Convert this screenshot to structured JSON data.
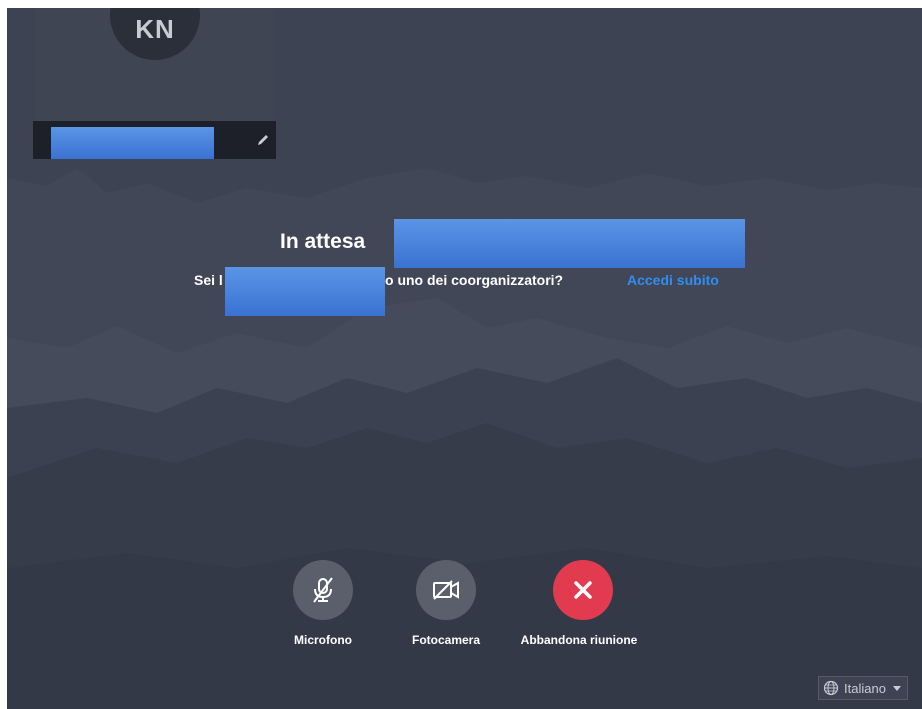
{
  "preview": {
    "initials": "KN"
  },
  "waiting": {
    "title": "In attesa",
    "question_prefix": "Sei l",
    "question_suffix": "o uno dei coorganizzatori?",
    "sign_in_link": "Accedi subito"
  },
  "controls": {
    "microphone_label": "Microfono",
    "camera_label": "Fotocamera",
    "leave_label": "Abbandona riunione"
  },
  "language": {
    "selected": "Italiano"
  },
  "colors": {
    "background": "#3d4352",
    "leave_button": "#e23b4f",
    "link": "#2f8ef0",
    "redaction": "#4a83dc"
  },
  "icons": {
    "edit": "pencil-icon",
    "microphone": "microphone-off-icon",
    "camera": "camera-off-icon",
    "leave": "close-icon",
    "language": "globe-icon"
  }
}
